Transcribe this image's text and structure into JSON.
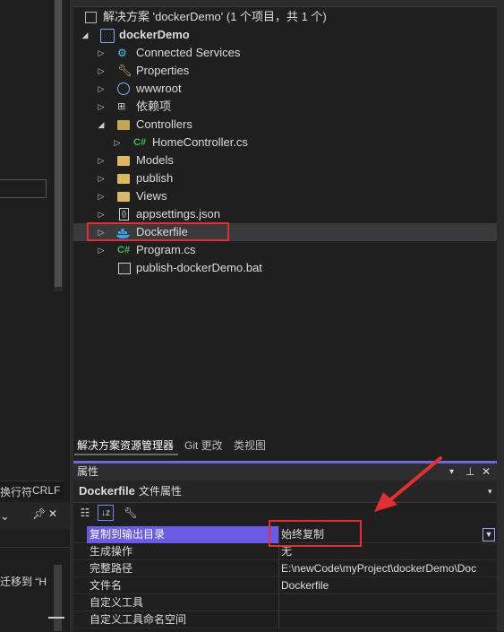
{
  "left": {
    "status_left": "换行符",
    "status_right": "CRLF",
    "cut_text": "迁移到 “H"
  },
  "solution": {
    "title": "解决方案 'dockerDemo' (1 个项目，共 1 个)",
    "project": "dockerDemo",
    "items": [
      {
        "label": "Connected Services",
        "icon": "connected-services-icon"
      },
      {
        "label": "Properties",
        "icon": "wrench-icon"
      },
      {
        "label": "wwwroot",
        "icon": "globe-icon"
      },
      {
        "label": "依赖项",
        "icon": "dependencies-icon"
      },
      {
        "label": "Controllers",
        "icon": "folder-open-icon"
      },
      {
        "label": "HomeController.cs",
        "icon": "csharp-file-icon"
      },
      {
        "label": "Models",
        "icon": "folder-icon"
      },
      {
        "label": "publish",
        "icon": "folder-icon"
      },
      {
        "label": "Views",
        "icon": "folder-icon"
      },
      {
        "label": "appsettings.json",
        "icon": "json-file-icon"
      },
      {
        "label": "Dockerfile",
        "icon": "docker-icon"
      },
      {
        "label": "Program.cs",
        "icon": "csharp-file-icon"
      },
      {
        "label": "publish-dockerDemo.bat",
        "icon": "batch-file-icon"
      }
    ],
    "csharp_glyph": "C#"
  },
  "tabs": [
    "解决方案资源管理器",
    "Git 更改",
    "类视图"
  ],
  "properties": {
    "title": "属性",
    "subject_name": "Dockerfile",
    "subject_type": "文件属性",
    "rows": [
      {
        "name": "复制到输出目录",
        "value": "始终复制"
      },
      {
        "name": "生成操作",
        "value": "无"
      },
      {
        "name": "完整路径",
        "value": "E:\\newCode\\myProject\\dockerDemo\\Doc"
      },
      {
        "name": "文件名",
        "value": "Dockerfile"
      },
      {
        "name": "自定义工具",
        "value": ""
      },
      {
        "name": "自定义工具命名空间",
        "value": ""
      }
    ]
  },
  "colors": {
    "selection": "#6a5be6",
    "highlight_box": "#e32f2f",
    "arrow": "#e32f2f"
  }
}
